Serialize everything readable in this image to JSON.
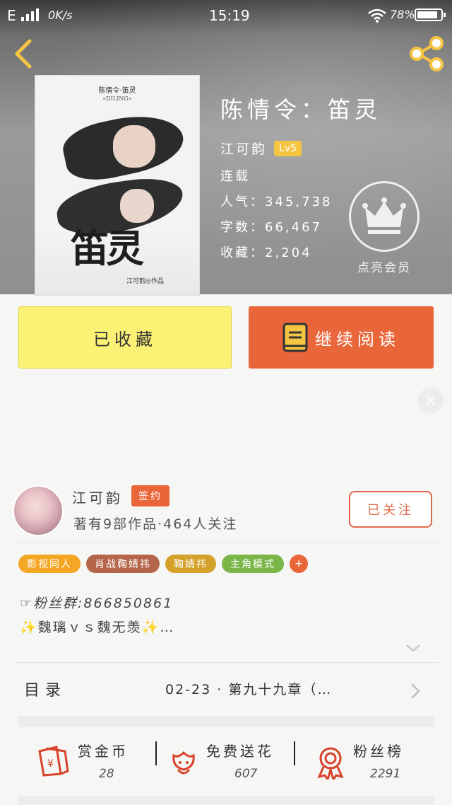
{
  "status_bar": {
    "network": "E",
    "speed": "0K/s",
    "time": "15:19",
    "battery": "78%"
  },
  "book": {
    "title": "陈情令：笛灵",
    "author": "江可韵",
    "level": "Lv5",
    "status": "连载",
    "popularity": "人气：345,738",
    "word_count": "字数：66,467",
    "favorites": "收藏：2,204"
  },
  "cover": {
    "top_text": "陈情令·笛灵",
    "sub_text": "«DILING»",
    "title_art": "笛灵",
    "author_text": "江可韵◎作品"
  },
  "vip": {
    "label": "点亮会员"
  },
  "actions": {
    "favorite_label": "已收藏",
    "read_label": "继续阅读"
  },
  "ad": {
    "close_label": "×"
  },
  "author_card": {
    "name": "江可韵",
    "signed_badge": "签约",
    "description": "著有9部作品·464人关注",
    "follow_label": "已关注"
  },
  "tags": [
    {
      "label": "影视同人",
      "color": "#f5a623"
    },
    {
      "label": "肖战鞠婧祎",
      "color": "#b5654a"
    },
    {
      "label": "鞠婧祎",
      "color": "#d4a12a"
    },
    {
      "label": "主角模式",
      "color": "#7ab648"
    }
  ],
  "tag_more": "+",
  "bio": {
    "line1": "☞粉丝群:866850861",
    "line2": "✨魏璃ｖｓ魏无羡✨…"
  },
  "toc": {
    "label": "目录",
    "latest": "02-23 · 第九十九章（…"
  },
  "stats": {
    "coins": {
      "label": "赏金币",
      "value": "28"
    },
    "flowers": {
      "label": "免费送花",
      "value": "607"
    },
    "fans": {
      "label": "粉丝榜",
      "value": "2291"
    }
  },
  "colors": {
    "accent": "#e8663a",
    "favorite_button": "#fbf175"
  }
}
